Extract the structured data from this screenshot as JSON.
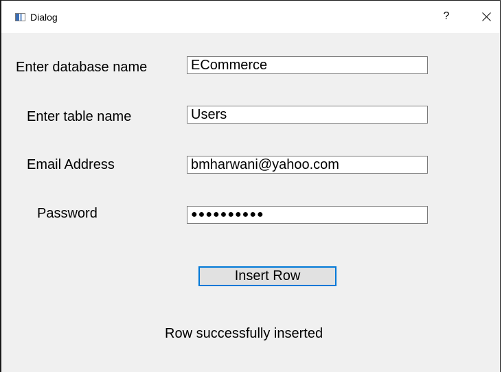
{
  "window": {
    "title": "Dialog",
    "help_label": "?"
  },
  "form": {
    "database": {
      "label": "Enter database name",
      "value": "ECommerce"
    },
    "table": {
      "label": "Enter table name",
      "value": "Users"
    },
    "email": {
      "label": "Email Address",
      "value": "bmharwani@yahoo.com"
    },
    "password": {
      "label": "Password",
      "value": "●●●●●●●●●●"
    }
  },
  "actions": {
    "insert_label": "Insert Row"
  },
  "status": {
    "message": "Row successfully inserted"
  },
  "icons": {
    "app": "window-icon",
    "close": "close-icon"
  },
  "colors": {
    "focus_border": "#0078d7",
    "dialog_bg": "#f0f0f0"
  }
}
